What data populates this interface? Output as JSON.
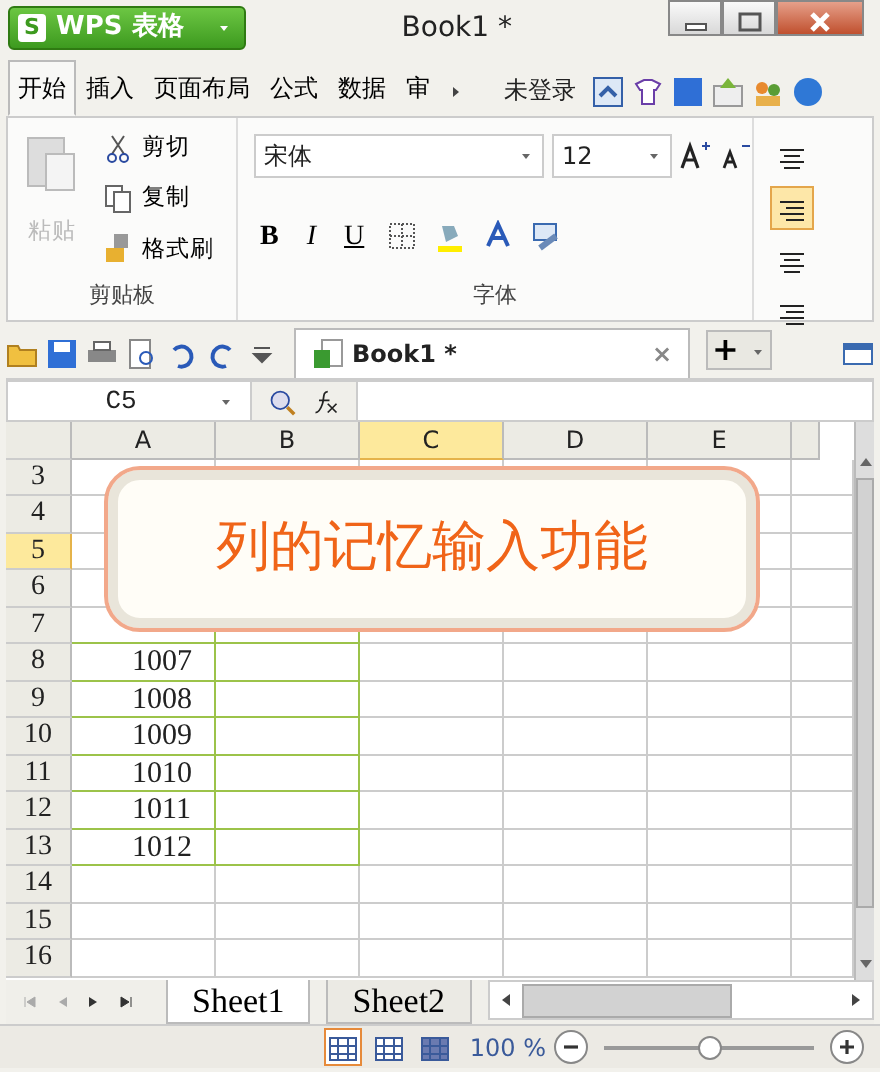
{
  "app": {
    "logo": "S",
    "brand": "WPS 表格",
    "title": "Book1 *"
  },
  "menu_tabs": [
    {
      "label": "开始",
      "selected": true
    },
    {
      "label": "插入",
      "selected": false
    },
    {
      "label": "页面布局",
      "selected": false
    },
    {
      "label": "公式",
      "selected": false
    },
    {
      "label": "数据",
      "selected": false
    },
    {
      "label": "审",
      "selected": false
    }
  ],
  "account": "未登录",
  "ribbon": {
    "clipboard": {
      "paste": {
        "label": "粘贴",
        "disabled": true
      },
      "cut": "剪切",
      "copy": "复制",
      "format_painter": "格式刷",
      "group_label": "剪贴板"
    },
    "font": {
      "font_name": "宋体",
      "font_size": "12",
      "bold": "B",
      "italic": "I",
      "underline": "U",
      "group_label": "字体"
    },
    "align": [
      {
        "selected": false
      },
      {
        "selected": true
      },
      {
        "selected": false
      },
      {
        "selected": false
      }
    ]
  },
  "document_tab": {
    "label": "Book1 *",
    "close": "×",
    "new": "+"
  },
  "name_box": "C5",
  "columns": [
    {
      "label": "A",
      "selected": false
    },
    {
      "label": "B",
      "selected": false
    },
    {
      "label": "C",
      "selected": true
    },
    {
      "label": "D",
      "selected": false
    },
    {
      "label": "E",
      "selected": false
    }
  ],
  "rows": [
    {
      "label": "3",
      "selected": false,
      "value": ""
    },
    {
      "label": "4",
      "selected": false,
      "value": ""
    },
    {
      "label": "5",
      "selected": true,
      "value": ""
    },
    {
      "label": "6",
      "selected": false,
      "value": ""
    },
    {
      "label": "7",
      "selected": false,
      "value": ""
    },
    {
      "label": "8",
      "selected": false,
      "value": "1007"
    },
    {
      "label": "9",
      "selected": false,
      "value": "1008"
    },
    {
      "label": "10",
      "selected": false,
      "value": "1009"
    },
    {
      "label": "11",
      "selected": false,
      "value": "1010"
    },
    {
      "label": "12",
      "selected": false,
      "value": "1011"
    },
    {
      "label": "13",
      "selected": false,
      "value": "1012"
    },
    {
      "label": "14",
      "selected": false,
      "value": ""
    },
    {
      "label": "15",
      "selected": false,
      "value": ""
    },
    {
      "label": "16",
      "selected": false,
      "value": ""
    }
  ],
  "callout": "列的记忆输入功能",
  "sheet_tabs": [
    {
      "label": "Sheet1",
      "selected": true
    },
    {
      "label": "Sheet2",
      "selected": false
    }
  ],
  "status_bar": {
    "views": [
      {
        "selected": true
      },
      {
        "selected": false
      },
      {
        "selected": false
      }
    ],
    "zoom": "100 %",
    "zoom_slider": {
      "level": 0.5
    }
  }
}
